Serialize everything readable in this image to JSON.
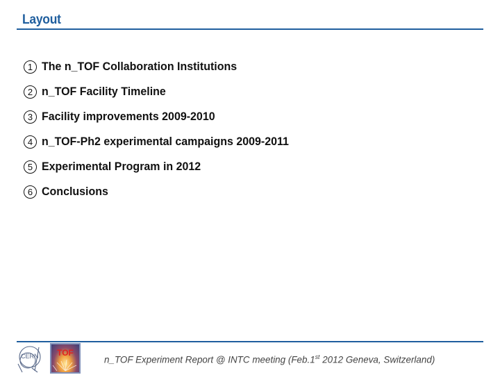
{
  "header": {
    "title": "Layout",
    "accent_color": "#1f5e9e"
  },
  "agenda": {
    "items": [
      {
        "number": "1",
        "label": "The n_TOF Collaboration Institutions"
      },
      {
        "number": "2",
        "label": "n_TOF Facility Timeline"
      },
      {
        "number": "3",
        "label": "Facility improvements 2009-2010"
      },
      {
        "number": "4",
        "label": "n_TOF-Ph2 experimental campaigns 2009-2011"
      },
      {
        "number": "5",
        "label": "Experimental Program in 2012"
      },
      {
        "number": "6",
        "label": "Conclusions"
      }
    ]
  },
  "footer": {
    "logos": [
      "cern-logo",
      "tof-logo"
    ],
    "tof_logo_text": "TOF",
    "text_before_sup": "n_TOF Experiment Report @ INTC meeting (Feb.1",
    "sup": "st",
    "text_after_sup": " 2012 Geneva, Switzerland)"
  }
}
